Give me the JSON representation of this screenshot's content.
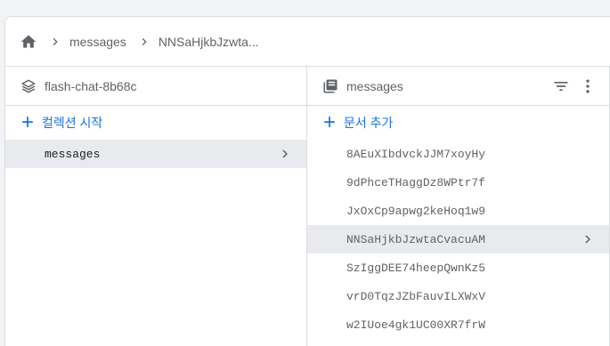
{
  "breadcrumb": {
    "home_icon": "home-icon",
    "items": [
      "messages",
      "NNSaHjkbJzwta..."
    ]
  },
  "column1": {
    "icon": "database-icon",
    "title": "flash-chat-8b68c",
    "add_label": "컬렉션 시작",
    "items": [
      {
        "label": "messages",
        "selected": true
      }
    ]
  },
  "column2": {
    "icon": "collection-icon",
    "title": "messages",
    "add_label": "문서 추가",
    "items": [
      {
        "label": "8AEuXIbdvckJJM7xoyHy",
        "selected": false
      },
      {
        "label": "9dPhceTHaggDz8WPtr7f",
        "selected": false
      },
      {
        "label": "JxOxCp9apwg2keHoq1w9",
        "selected": false
      },
      {
        "label": "NNSaHjkbJzwtaCvacuAM",
        "selected": true
      },
      {
        "label": "SzIggDEE74heepQwnKz5",
        "selected": false
      },
      {
        "label": "vrD0TqzJZbFauvILXWxV",
        "selected": false
      },
      {
        "label": "w2IUoe4gk1UC00XR7frW",
        "selected": false
      }
    ]
  },
  "colors": {
    "accent": "#1a73e8",
    "selected_row": "#e8eaed",
    "border": "#dadce0",
    "text": "#5f6368"
  }
}
